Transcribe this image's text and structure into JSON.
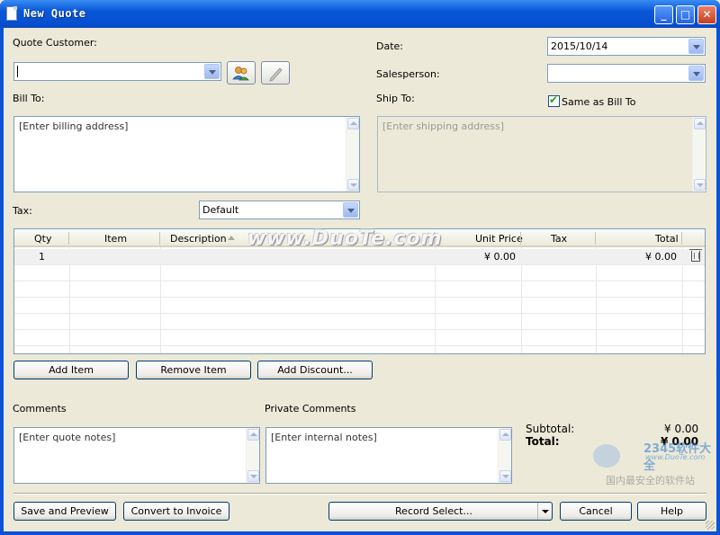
{
  "window": {
    "title": "New Quote",
    "buttons": {
      "minimize": "_",
      "maximize": "□",
      "close": "✕"
    }
  },
  "customer": {
    "label": "Quote Customer:",
    "value": "",
    "buttons": {
      "contacts_icon": "contacts-icon",
      "edit_icon": "edit-icon"
    }
  },
  "date": {
    "label": "Date:",
    "value": "2015/10/14"
  },
  "salesperson": {
    "label": "Salesperson:",
    "value": ""
  },
  "bill_to": {
    "label": "Bill To:",
    "placeholder": "[Enter billing address]"
  },
  "ship_to": {
    "label": "Ship To:",
    "placeholder": "[Enter shipping address]",
    "same_as_bill_label": "Same as Bill To",
    "same_as_bill_checked": true
  },
  "tax": {
    "label": "Tax:",
    "value": "Default"
  },
  "items_table": {
    "columns": [
      "Qty",
      "Item",
      "Description",
      "Unit Price",
      "Tax",
      "Total"
    ],
    "rows": [
      {
        "qty": "1",
        "item": "",
        "description": "",
        "unit_price": "¥ 0.00",
        "tax": "",
        "total": "¥ 0.00"
      }
    ]
  },
  "item_buttons": {
    "add_item": "Add Item",
    "remove_item": "Remove Item",
    "add_discount": "Add Discount..."
  },
  "comments": {
    "label": "Comments",
    "placeholder": "[Enter quote notes]"
  },
  "private_comments": {
    "label": "Private Comments",
    "placeholder": "[Enter internal notes]"
  },
  "totals": {
    "subtotal_label": "Subtotal:",
    "subtotal_value": "¥ 0.00",
    "total_label": "Total:",
    "total_value": "¥ 0.00"
  },
  "footer": {
    "save_preview": "Save and Preview",
    "convert_invoice": "Convert to Invoice",
    "record_select": "Record Select...",
    "cancel": "Cancel",
    "help": "Help"
  },
  "watermarks": {
    "center": "www.DuoTe.com",
    "corner_logo": "2345软件大全",
    "corner_site": "www.DuoTe.com",
    "corner_tag": "国内最安全的软件站"
  },
  "colors": {
    "titlebar": "#0857d8",
    "client_bg": "#ece9d8",
    "field_border": "#7f9db9"
  }
}
